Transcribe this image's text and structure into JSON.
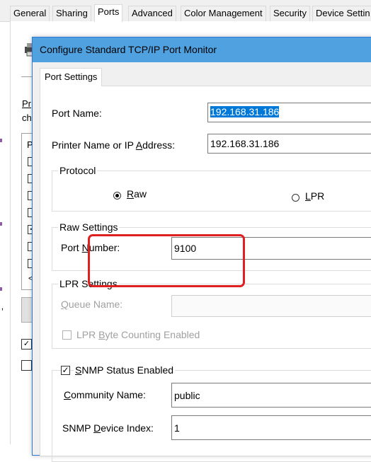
{
  "background_window": {
    "tabs": [
      "General",
      "Sharing",
      "Ports",
      "Advanced",
      "Color Management",
      "Security",
      "Device Settin"
    ],
    "active_tab": "Ports",
    "desc_line1": "Pr",
    "desc_line2": "ch",
    "list_header": "P",
    "list_rows": [
      false,
      false,
      false,
      false,
      true,
      false,
      false
    ],
    "side_checkboxes": [
      true,
      false
    ],
    "left_glyph": "‚",
    "colors": {
      "tab_border": "#d9d9d9",
      "panel": "#ffffff",
      "accent_mark": "#8e5ba8"
    }
  },
  "dialog": {
    "title": "Configure Standard TCP/IP Port Monitor",
    "tab": "Port Settings",
    "port_name": {
      "label_pre": "Port Name:",
      "value": "192.168.31.186"
    },
    "printer_name": {
      "label_pre": "Printer Name or IP ",
      "label_ul": "A",
      "label_post": "ddress:",
      "value": "192.168.31.186"
    },
    "protocol": {
      "caption": "Protocol",
      "raw_label": "Raw",
      "raw_ul": "R",
      "raw_rest": "aw",
      "lpr_label": "LPR",
      "lpr_ul": "L",
      "lpr_rest": "PR",
      "selected": "Raw"
    },
    "raw_settings": {
      "caption": "Raw Settings",
      "port_label_pre": "Port ",
      "port_label_ul": "N",
      "port_label_post": "umber:",
      "port_value": "9100"
    },
    "lpr_settings": {
      "caption": "LPR Settings",
      "queue_label_ul": "Q",
      "queue_label_post": "ueue Name:",
      "byte_label_pre": "LPR ",
      "byte_label_ul": "B",
      "byte_label_post": "yte Counting Enabled"
    },
    "snmp": {
      "caption_ul": "S",
      "caption_post": "NMP Status Enabled",
      "checked": true,
      "community_label_ul": "C",
      "community_label_post": "ommunity Name:",
      "community_value": "public",
      "device_label_pre": "SNMP ",
      "device_label_ul": "D",
      "device_label_post": "evice Index:",
      "device_value": "1"
    },
    "colors": {
      "titlebar": "#4fa1e0",
      "border": "#2b79d8",
      "selection": "#0078d7",
      "highlight": "#e02020"
    }
  }
}
